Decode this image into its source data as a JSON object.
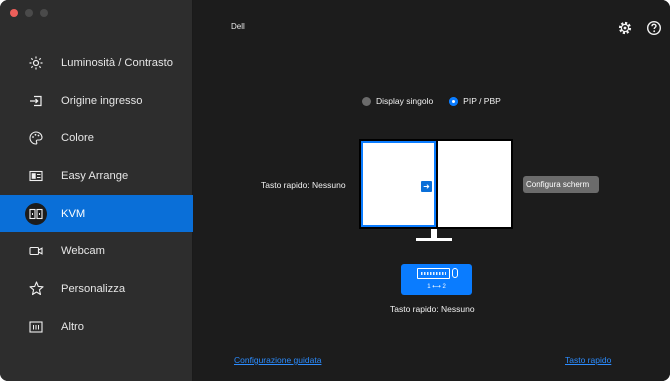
{
  "window": {
    "traffic_lights": [
      "close",
      "minimize",
      "zoom"
    ]
  },
  "sidebar": {
    "items": [
      {
        "label": "Luminosità / Contrasto",
        "icon": "brightness-icon"
      },
      {
        "label": "Origine ingresso",
        "icon": "input-source-icon"
      },
      {
        "label": "Colore",
        "icon": "palette-icon"
      },
      {
        "label": "Easy Arrange",
        "icon": "layout-icon"
      },
      {
        "label": "KVM",
        "icon": "kvm-icon",
        "active": true
      },
      {
        "label": "Webcam",
        "icon": "webcam-icon"
      },
      {
        "label": "Personalizza",
        "icon": "star-icon"
      },
      {
        "label": "Altro",
        "icon": "more-icon"
      }
    ]
  },
  "header": {
    "brand": "Dell"
  },
  "main": {
    "mode": {
      "options": [
        "Display singolo",
        "PIP / PBP"
      ],
      "selected": "PIP / PBP"
    },
    "hotkey_left": "Tasto rapido: Nessuno",
    "config_button": "Configura scherm",
    "kvm_button_label": "1 ⟷ 2",
    "hotkey_bottom": "Tasto rapido: Nessuno",
    "links": {
      "setup": "Configurazione guidata",
      "hotkey": "Tasto rapido"
    }
  },
  "colors": {
    "accent": "#0a7cff",
    "active_nav": "#0a6fd8",
    "sidebar_bg": "#2d2d2d",
    "main_bg": "#1c1c1c"
  }
}
